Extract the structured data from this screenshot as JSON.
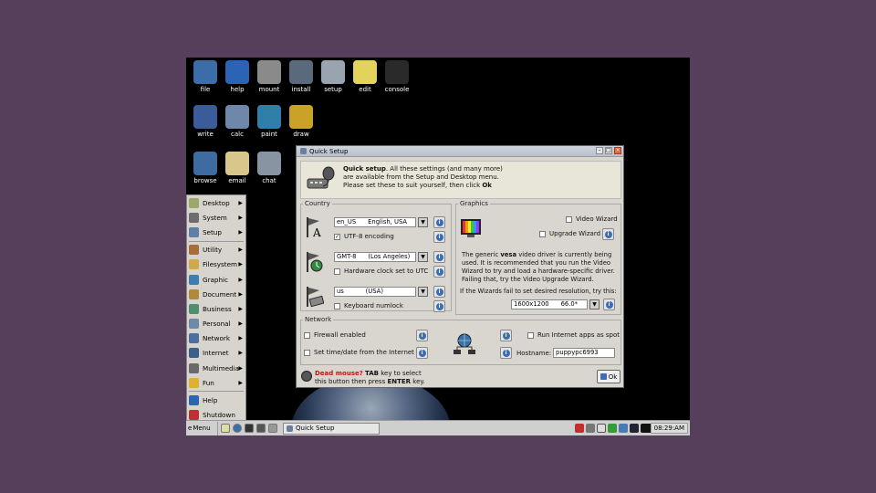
{
  "desktop_icons": [
    {
      "label": "file",
      "icon": "file-manager-icon",
      "color": "#3b6ea8"
    },
    {
      "label": "help",
      "icon": "help-icon",
      "color": "#2b63b5"
    },
    {
      "label": "mount",
      "icon": "drive-icon",
      "color": "#8a8a8a"
    },
    {
      "label": "install",
      "icon": "install-icon",
      "color": "#5a6a7c"
    },
    {
      "label": "setup",
      "icon": "setup-icon",
      "color": "#9aa4b0"
    },
    {
      "label": "edit",
      "icon": "edit-icon",
      "color": "#e3d35a"
    },
    {
      "label": "console",
      "icon": "console-icon",
      "color": "#2a2a2a"
    },
    {
      "label": "write",
      "icon": "write-icon",
      "color": "#3a5d9a"
    },
    {
      "label": "calc",
      "icon": "calc-icon",
      "color": "#6f87a8"
    },
    {
      "label": "paint",
      "icon": "paint-icon",
      "color": "#2f7fa8"
    },
    {
      "label": "draw",
      "icon": "draw-icon",
      "color": "#c9a227"
    },
    {
      "label": "browse",
      "icon": "browse-icon",
      "color": "#3e6ca0"
    },
    {
      "label": "email",
      "icon": "email-icon",
      "color": "#d7c78a"
    },
    {
      "label": "chat",
      "icon": "chat-icon",
      "color": "#8894a2"
    }
  ],
  "menu": [
    {
      "label": "Desktop",
      "arrow": true,
      "icon": "desktop-icon",
      "color": "#9aa86a"
    },
    {
      "label": "System",
      "arrow": true,
      "icon": "system-icon",
      "color": "#6d6d6d"
    },
    {
      "label": "Setup",
      "arrow": true,
      "icon": "setup-icon",
      "color": "#5f7fa8"
    },
    {
      "label": "Utility",
      "arrow": true,
      "icon": "utility-icon",
      "color": "#a86d3a"
    },
    {
      "label": "Filesystem",
      "arrow": true,
      "icon": "filesystem-icon",
      "color": "#d1a84a"
    },
    {
      "label": "Graphic",
      "arrow": true,
      "icon": "graphic-icon",
      "color": "#3d7db0"
    },
    {
      "label": "Document",
      "arrow": true,
      "icon": "document-icon",
      "color": "#b08a3a"
    },
    {
      "label": "Business",
      "arrow": true,
      "icon": "business-icon",
      "color": "#4f8f6f"
    },
    {
      "label": "Personal",
      "arrow": true,
      "icon": "personal-icon",
      "color": "#6f8aa8"
    },
    {
      "label": "Network",
      "arrow": true,
      "icon": "network-icon",
      "color": "#4a6fa0"
    },
    {
      "label": "Internet",
      "arrow": true,
      "icon": "internet-icon",
      "color": "#3c5e8a"
    },
    {
      "label": "Multimedia",
      "arrow": true,
      "icon": "multimedia-icon",
      "color": "#6a6a6a"
    },
    {
      "label": "Fun",
      "arrow": true,
      "icon": "fun-icon",
      "color": "#e0b030"
    },
    {
      "label": "Help",
      "arrow": false,
      "icon": "help-icon",
      "color": "#2b63b5"
    },
    {
      "label": "Shutdown",
      "arrow": false,
      "icon": "shutdown-icon",
      "color": "#c03030"
    }
  ],
  "window": {
    "title": "Quick Setup",
    "header_bold": "Quick setup",
    "header_line1": ". All these settings (and many more)",
    "header_line2": "are available from the Setup and Desktop menu.",
    "header_line3": "Please set these to suit yourself, then click ",
    "header_ok": "Ok",
    "country": {
      "legend": "Country",
      "locale": "en_US      English, USA",
      "utf8_label": "UTF-8 encoding",
      "utf8_checked": true,
      "timezone": "GMT-8      (Los Angeles)",
      "utc_label": "Hardware clock set to UTC",
      "keyboard": "us           (USA)",
      "numlock_label": "Keyboard numlock"
    },
    "graphics": {
      "legend": "Graphics",
      "video_wizard_label": "Video Wizard",
      "upgrade_wizard_label": "Upgrade Wizard",
      "desc_line1_pre": "The generic ",
      "desc_vesa": "vesa",
      "desc_line1_post": " video driver is currently being",
      "desc_line2": "used. It is recommended that you run the Video",
      "desc_line3": "Wizard to try and load a hardware-specific driver.",
      "desc_line4": "Failing that, try the Video Upgrade Wizard.",
      "resolution_hint": "If the Wizards fail to set desired resolution, try this:",
      "resolution": "1600x1200      66.0*"
    },
    "network": {
      "legend": "Network",
      "firewall_label": "Firewall enabled",
      "time_label": "Set time/date from the Internet",
      "spot_label": "Run Internet apps as spot",
      "hostname_label": "Hostname:",
      "hostname_value": "puppypc6993"
    },
    "footer_red": "Dead mouse?",
    "footer_bold_tab": "TAB",
    "footer_line1_post": " key to select",
    "footer_line2_pre": "this button then press ",
    "footer_enter": "ENTER",
    "footer_line2_post": " key.",
    "ok_label": "Ok"
  },
  "taskbar": {
    "menu_label": "Menu",
    "task_label": "Quick Setup",
    "clock": "08:29:AM"
  }
}
